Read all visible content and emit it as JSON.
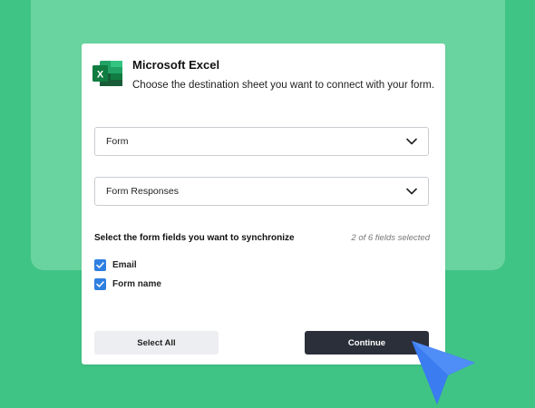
{
  "app": {
    "title": "Microsoft Excel",
    "subtitle": "Choose the destination sheet you want to connect with your form.",
    "logo_icon": "excel-logo-icon",
    "logo_letter": "X"
  },
  "selects": [
    {
      "value": "Form",
      "icon": "chevron-down-icon"
    },
    {
      "value": "Form Responses",
      "icon": "chevron-down-icon"
    }
  ],
  "fields": {
    "section_label": "Select the form fields you want to synchronize",
    "count_label": "2 of 6 fields selected",
    "items": [
      {
        "label": "Email",
        "checked": true
      },
      {
        "label": "Form name",
        "checked": true
      }
    ]
  },
  "buttons": {
    "select_all": "Select All",
    "continue": "Continue"
  },
  "colors": {
    "background": "#40c486",
    "panel": "#69d49f",
    "checkbox": "#2f7fe0",
    "primary_button": "#2b2f3a",
    "cursor": "#3b82f6"
  }
}
